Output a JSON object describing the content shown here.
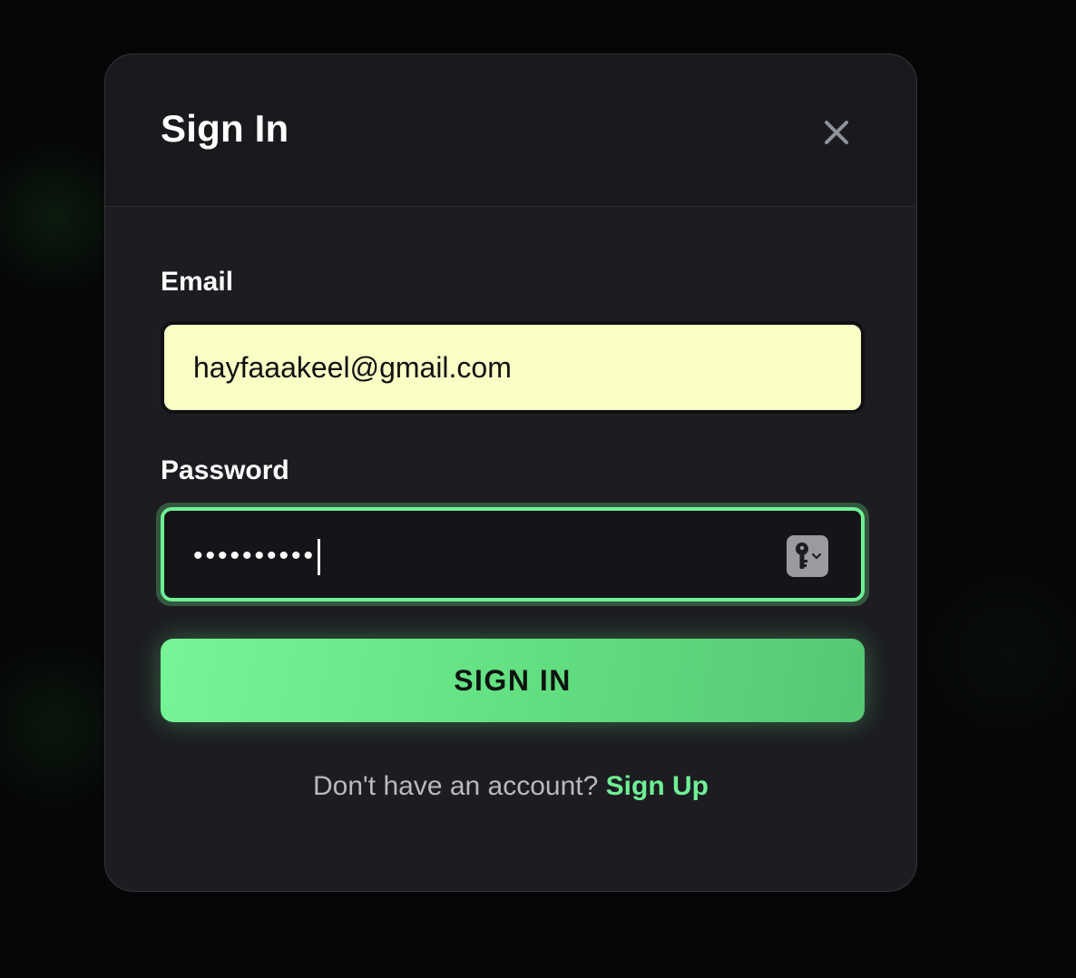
{
  "dialog": {
    "title": "Sign In"
  },
  "form": {
    "email_label": "Email",
    "email_value": "hayfaaakeel@gmail.com",
    "password_label": "Password",
    "password_masked": "••••••••••"
  },
  "actions": {
    "submit_label": "SIGN IN"
  },
  "footer": {
    "prompt": "Don't have an account?",
    "signup_label": "Sign Up"
  },
  "icons": {
    "close": "close-icon",
    "password_manager": "key-icon"
  },
  "colors": {
    "accent": "#6ff095",
    "modal_bg": "#1c1c21",
    "autofill_bg": "#f9ffc5"
  }
}
